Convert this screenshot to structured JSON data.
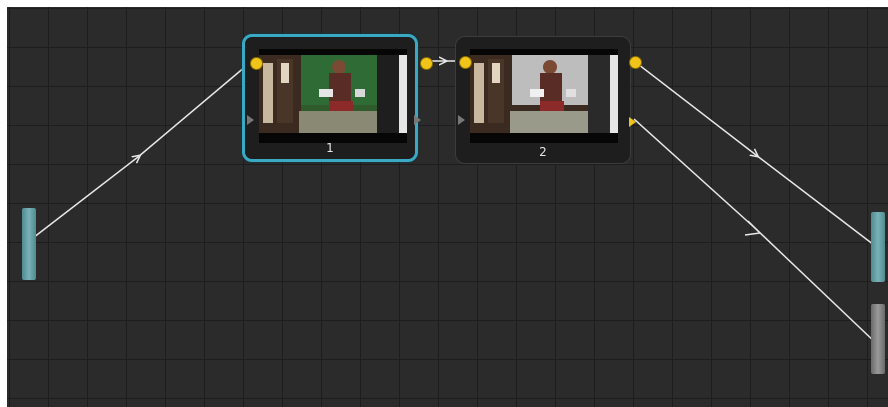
{
  "nodes": [
    {
      "label": "1",
      "selected": true
    },
    {
      "label": "2",
      "selected": false
    }
  ],
  "colors": {
    "canvas_bg": "#2b2b2b",
    "grid_line": "#1d1d1d",
    "selection": "#3aa9c4",
    "port_output": "#f0c419",
    "wire": "#e8e8e8",
    "input_port": "#6fa6aa",
    "output_port": "#8a8a8a"
  },
  "icons": {
    "output_port": "yellow-circle",
    "input_port": "grey-triangle",
    "wire_arrow": "arrowhead"
  }
}
